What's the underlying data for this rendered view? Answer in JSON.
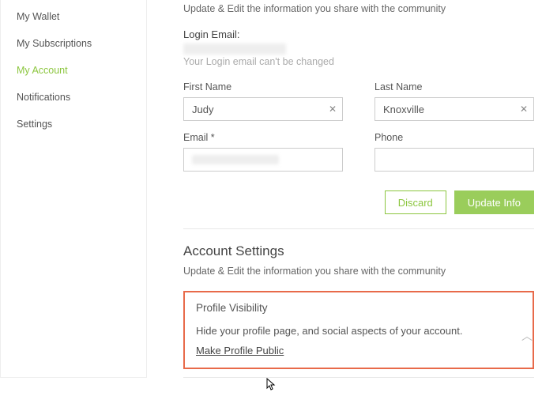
{
  "sidebar": {
    "items": [
      {
        "label": "My Wallet"
      },
      {
        "label": "My Subscriptions"
      },
      {
        "label": "My Account"
      },
      {
        "label": "Notifications"
      },
      {
        "label": "Settings"
      }
    ]
  },
  "profile": {
    "subheading": "Update & Edit the information you share with the community",
    "login_email_label": "Login Email:",
    "login_email_hint": "Your Login email can't be changed",
    "first_name_label": "First Name",
    "first_name_value": "Judy",
    "last_name_label": "Last Name",
    "last_name_value": "Knoxville",
    "email_label": "Email *",
    "phone_label": "Phone",
    "phone_value": "",
    "discard_label": "Discard",
    "update_label": "Update Info"
  },
  "account": {
    "title": "Account Settings",
    "subheading": "Update & Edit the information you share with the community"
  },
  "visibility": {
    "title": "Profile Visibility",
    "desc": "Hide your profile page, and social aspects of your account.",
    "link": "Make Profile Public"
  }
}
